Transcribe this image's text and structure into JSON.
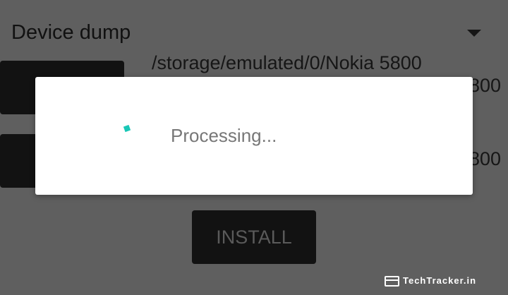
{
  "spinner": {
    "selected": "Device dump",
    "icon": "dropdown-arrow-icon"
  },
  "paths": {
    "line1": "/storage/emulated/0/Nokia 5800",
    "line2_fragment": "800",
    "line3_fragment": "800"
  },
  "install_button": {
    "label": "INSTALL"
  },
  "dialog": {
    "message": "Processing...",
    "icon": "progress-spinner-icon",
    "accent": "#19c7b6"
  },
  "watermark": {
    "text": "TechTracker.in",
    "icon": "browser-window-icon"
  },
  "colors": {
    "overlay_background": "#5f5f5f",
    "button_dark": "#121212",
    "dialog_background": "#ffffff"
  }
}
